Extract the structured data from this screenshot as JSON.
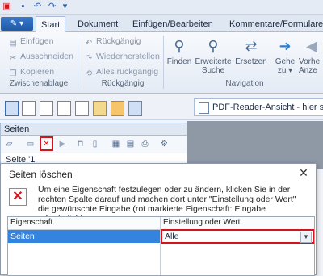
{
  "quick_access": {
    "icons": [
      "app-logo-icon",
      "save-icon",
      "undo-icon",
      "redo-icon",
      "customize-icon"
    ]
  },
  "tabs": {
    "file_label": "",
    "items": [
      {
        "label": "Start",
        "active": true
      },
      {
        "label": "Dokument"
      },
      {
        "label": "Einfügen/Bearbeiten"
      },
      {
        "label": "Kommentare/Formulare"
      }
    ]
  },
  "ribbon": {
    "clipboard": {
      "label": "Zwischenablage",
      "einfuegen": "Einfügen",
      "ausschneiden": "Ausschneiden",
      "kopieren": "Kopieren"
    },
    "undo": {
      "label": "Rückgängig",
      "rueckgaengig": "Rückgängig",
      "wiederherstellen": "Wiederherstellen",
      "alles_rueckgaengig": "Alles rückgängig"
    },
    "navigation": {
      "label": "Navigation",
      "finden": "Finden",
      "erweiterte_suche_1": "Erweiterte",
      "erweiterte_suche_2": "Suche",
      "ersetzen": "Ersetzen",
      "gehe_1": "Gehe",
      "gehe_2": "zu",
      "vorherige_1": "Vorhe",
      "vorherige_2": "Anze"
    }
  },
  "viewbar": {
    "pdf_reader_view": "PDF-Reader-Ansicht - hier sehen"
  },
  "pages_panel": {
    "title": "Seiten",
    "item": "Seite '1'"
  },
  "dialog": {
    "title": "Seiten löschen",
    "close": "✕",
    "info": "Um eine Eigenschaft festzulegen oder zu ändern, klicken Sie in der rechten Spalte darauf und machen dort unter \"Einstellung oder Wert\" die gewünschte Eingabe (rot markierte Eigenschaft: Eingabe erforderlich).",
    "grid": {
      "col_property": "Eigenschaft",
      "col_value": "Einstellung oder Wert",
      "rows": [
        {
          "property": "Seiten",
          "value": "Alle"
        }
      ]
    }
  },
  "colors": {
    "highlight_red": "#d4141a",
    "selection_blue": "#3483de"
  }
}
